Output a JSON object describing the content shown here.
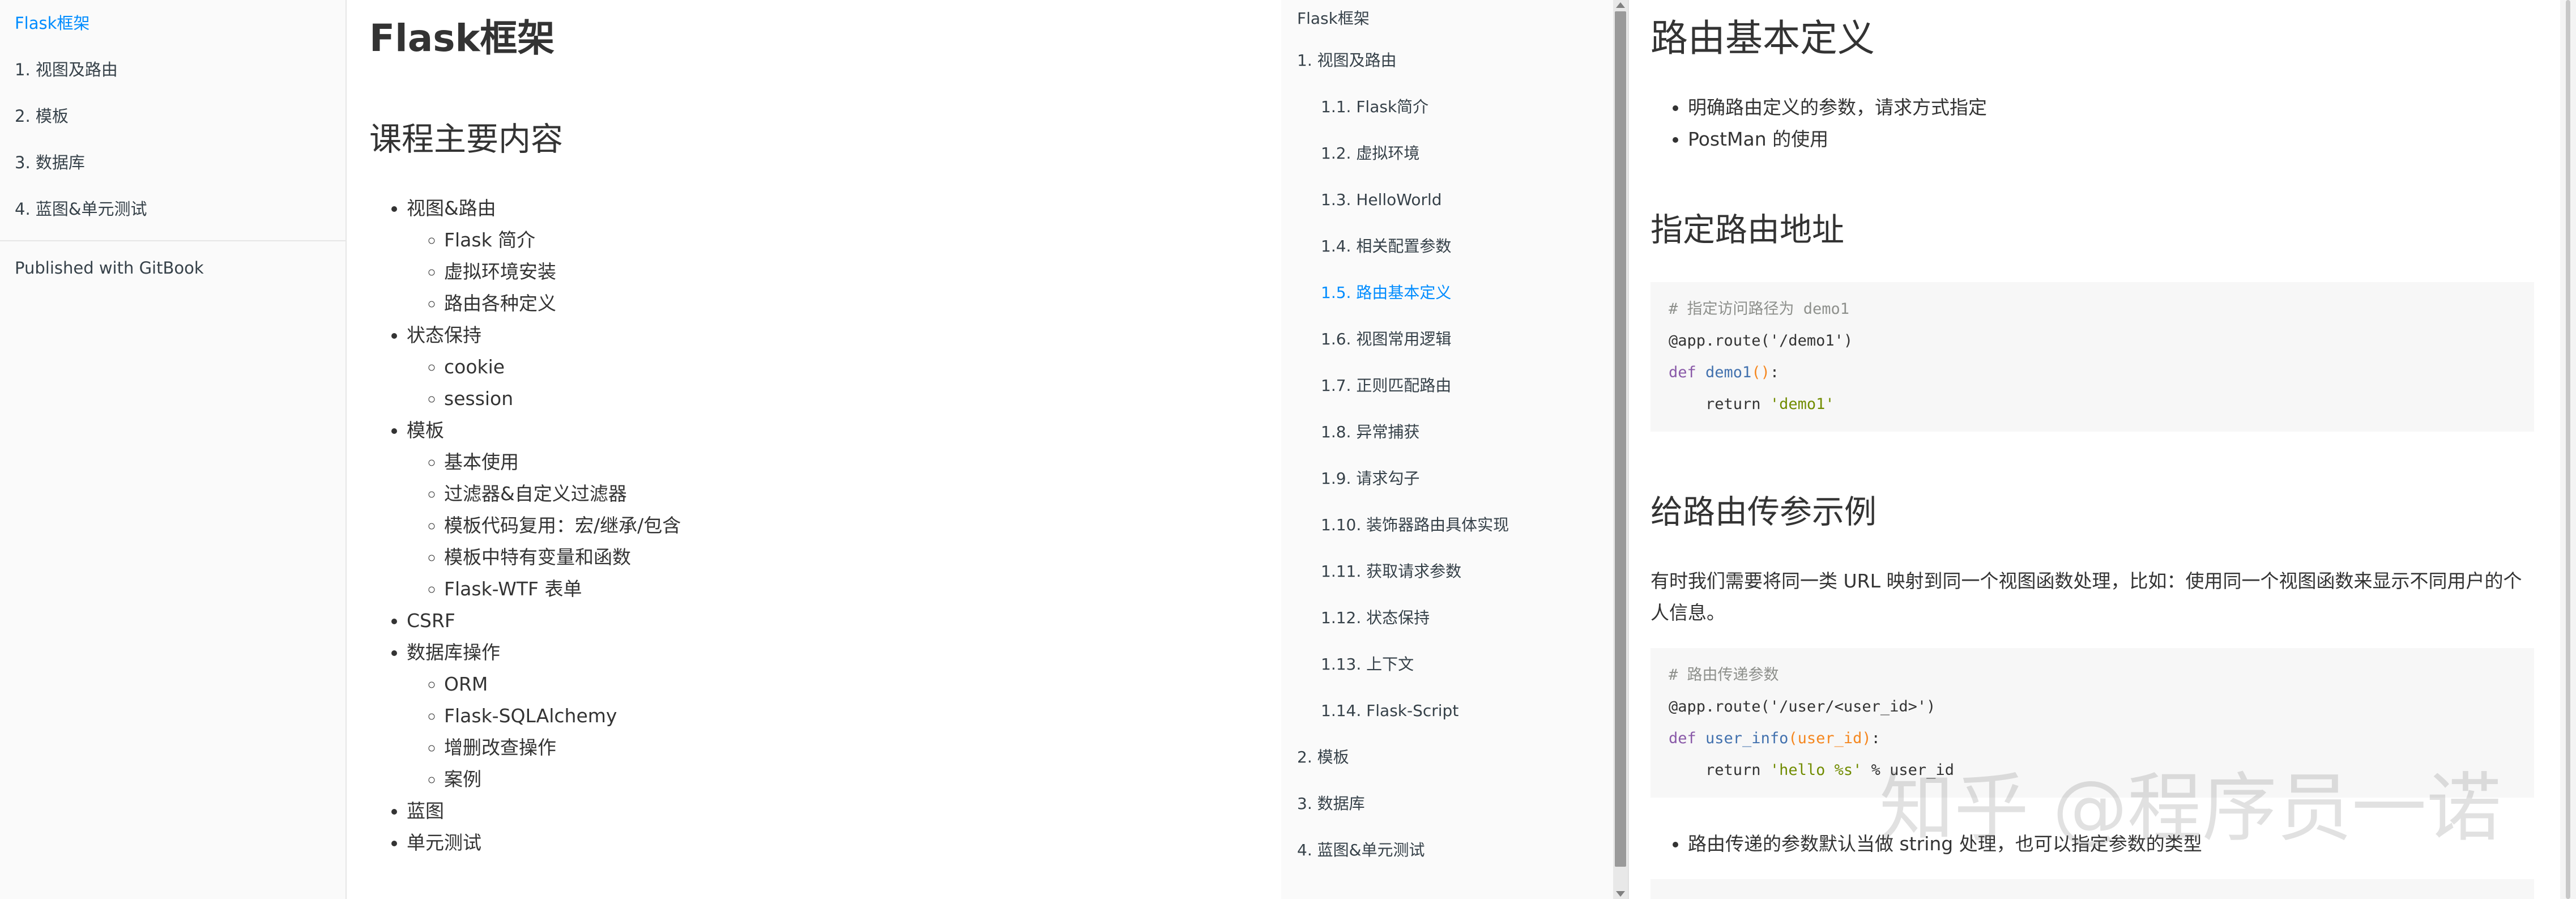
{
  "left": {
    "sidebar": {
      "items": [
        {
          "label": "Flask框架",
          "active": true
        },
        {
          "label": "1. 视图及路由"
        },
        {
          "label": "2. 模板"
        },
        {
          "label": "3. 数据库"
        },
        {
          "label": "4. 蓝图&单元测试"
        }
      ],
      "published": "Published with GitBook"
    },
    "content": {
      "title": "Flask框架",
      "subtitle": "课程主要内容",
      "outline": [
        {
          "label": "视图&路由",
          "children": [
            "Flask 简介",
            "虚拟环境安装",
            "路由各种定义"
          ]
        },
        {
          "label": "状态保持",
          "children": [
            "cookie",
            "session"
          ]
        },
        {
          "label": "模板",
          "children": [
            "基本使用",
            "过滤器&自定义过滤器",
            "模板代码复用：宏/继承/包含",
            "模板中特有变量和函数",
            "Flask-WTF 表单"
          ]
        },
        {
          "label": "CSRF",
          "children": []
        },
        {
          "label": "数据库操作",
          "children": [
            "ORM",
            "Flask-SQLAlchemy",
            "增删改查操作",
            "案例"
          ]
        },
        {
          "label": "蓝图",
          "children": []
        },
        {
          "label": "单元测试",
          "children": []
        }
      ]
    }
  },
  "right": {
    "sidebar": {
      "items": [
        {
          "label": "Flask框架",
          "level": 0
        },
        {
          "label": "1. 视图及路由",
          "level": 0
        },
        {
          "label": "1.1. Flask简介",
          "level": 1
        },
        {
          "label": "1.2. 虚拟环境",
          "level": 1
        },
        {
          "label": "1.3. HelloWorld",
          "level": 1
        },
        {
          "label": "1.4. 相关配置参数",
          "level": 1
        },
        {
          "label": "1.5. 路由基本定义",
          "level": 1,
          "active": true
        },
        {
          "label": "1.6. 视图常用逻辑",
          "level": 1
        },
        {
          "label": "1.7. 正则匹配路由",
          "level": 1
        },
        {
          "label": "1.8. 异常捕获",
          "level": 1
        },
        {
          "label": "1.9. 请求勾子",
          "level": 1
        },
        {
          "label": "1.10. 装饰器路由具体实现",
          "level": 1
        },
        {
          "label": "1.11. 获取请求参数",
          "level": 1
        },
        {
          "label": "1.12. 状态保持",
          "level": 1
        },
        {
          "label": "1.13. 上下文",
          "level": 1
        },
        {
          "label": "1.14. Flask-Script",
          "level": 1
        },
        {
          "label": "2. 模板",
          "level": 0
        },
        {
          "label": "3. 数据库",
          "level": 0
        },
        {
          "label": "4. 蓝图&单元测试",
          "level": 0
        }
      ]
    },
    "content": {
      "title": "路由基本定义",
      "intro_bullets": [
        "明确路由定义的参数，请求方式指定",
        "PostMan 的使用"
      ],
      "section1_title": "指定路由地址",
      "code1": [
        [
          {
            "t": "# 指定访问路径为 demo1",
            "c": "comment"
          }
        ],
        [
          {
            "t": "@app.route('/demo1')",
            "c": "plain"
          }
        ],
        [
          {
            "t": "def ",
            "c": "keyword"
          },
          {
            "t": "demo1",
            "c": "fn"
          },
          {
            "t": "()",
            "c": "paren"
          },
          {
            "t": ":",
            "c": "plain"
          }
        ],
        [
          {
            "t": "    return ",
            "c": "plain"
          },
          {
            "t": "'demo1'",
            "c": "string"
          }
        ]
      ],
      "section2_title": "给路由传参示例",
      "paragraph": "有时我们需要将同一类 URL 映射到同一个视图函数处理，比如：使用同一个视图函数来显示不同用户的个人信息。",
      "code2": [
        [
          {
            "t": "# 路由传递参数",
            "c": "comment"
          }
        ],
        [
          {
            "t": "@app.route('/user/<user_id>')",
            "c": "plain"
          }
        ],
        [
          {
            "t": "def ",
            "c": "keyword"
          },
          {
            "t": "user_info",
            "c": "fn"
          },
          {
            "t": "(user_id)",
            "c": "paren"
          },
          {
            "t": ":",
            "c": "plain"
          }
        ],
        [
          {
            "t": "    return ",
            "c": "plain"
          },
          {
            "t": "'hello %s'",
            "c": "string"
          },
          {
            "t": " % ",
            "c": "plain"
          },
          {
            "t": "user_id",
            "c": "plain"
          }
        ]
      ],
      "after_bullet": "路由传递的参数默认当做 string 处理，也可以指定参数的类型"
    }
  },
  "watermark": "知乎 @程序员一诺"
}
